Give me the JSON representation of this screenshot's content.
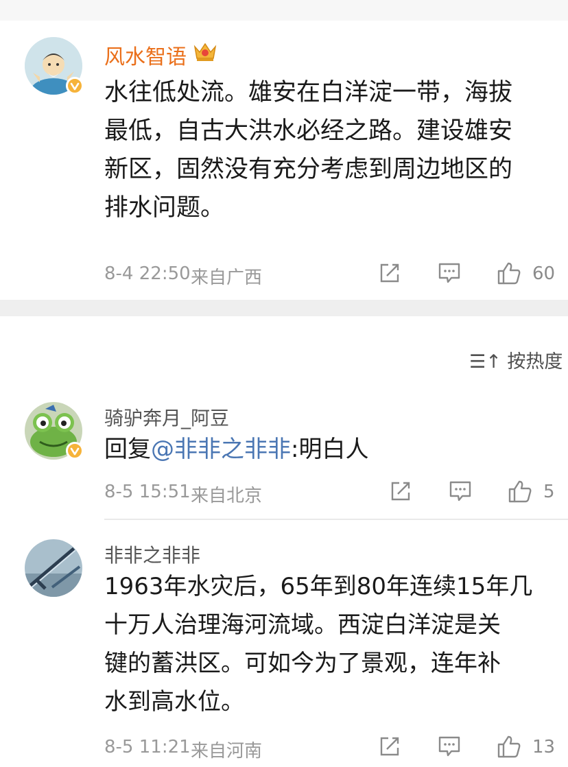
{
  "colors": {
    "username": "#ea6f1a",
    "username_gray": "#555555",
    "mention": "#4a76b3",
    "meta": "#999999",
    "badge": "#f6b33a",
    "separator": "#e9e9e9"
  },
  "main_post": {
    "username": "风水智语",
    "crown_icon": "crown-icon",
    "content_lines": [
      "水往低处流。雄安在白洋淀一带，海拔",
      "最低，自古大洪水必经之路。建设雄安",
      "新区，固然没有充分考虑到周边地区的",
      "排水问题。"
    ],
    "time": "8-4 22:50",
    "location": "来自广西",
    "likes": "60"
  },
  "sort_label": "按热度",
  "comments": [
    {
      "username": "骑驴奔月_阿豆",
      "reply_prefix": "回复",
      "mention": "@非非之非非",
      "reply_text": ":明白人",
      "time": "8-5 15:51",
      "location": "来自北京",
      "likes": "5"
    },
    {
      "username": "非非之非非",
      "content_lines": [
        "1963年水灾后，65年到80年连续15年几",
        "十万人治理海河流域。西淀白洋淀是关",
        "键的蓄洪区。可如今为了景观，连年补",
        "水到高水位。"
      ],
      "time": "8-5 11:21",
      "location": "来自河南",
      "likes": "13"
    }
  ]
}
